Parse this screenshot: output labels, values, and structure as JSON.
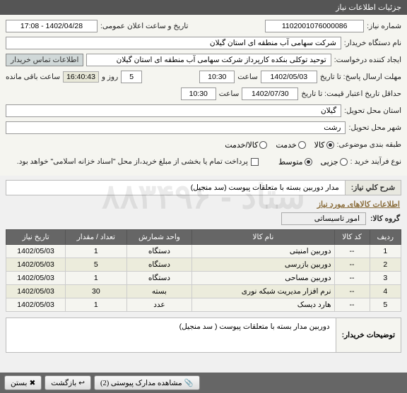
{
  "panel_title": "جزئیات اطلاعات نیاز",
  "watermark": "ستاد - ۸۸۳۴۹۶",
  "form": {
    "need_no_label": "شماره نیاز:",
    "need_no": "1102001076000086",
    "public_announce_label": "تاریخ و ساعت اعلان عمومی:",
    "public_announce": "1402/04/28 - 17:08",
    "buyer_org_label": "نام دستگاه خریدار:",
    "buyer_org": "شرکت سهامی آب منطقه ای استان گیلان",
    "requester_label": "ایجاد کننده درخواست:",
    "requester": "توحید توکلی بنکده کارپرداز شرکت سهامی آب منطقه ای استان گیلان",
    "contact_label": "اطلاعات تماس خریدار",
    "deadline_label": "مهلت ارسال پاسخ: تا تاریخ",
    "deadline_date": "1402/05/03",
    "time_label": "ساعت",
    "deadline_time": "10:30",
    "days": "5",
    "days_label": "روز و",
    "remaining_time": "16:40:43",
    "remaining_label": "ساعت باقی مانده",
    "credit_label": "حداقل تاریخ اعتبار قیمت: تا تاریخ",
    "credit_date": "1402/07/30",
    "credit_time": "10:30",
    "province_label": "استان محل تحویل:",
    "province": "گیلان",
    "city_label": "شهر محل تحویل:",
    "city": "رشت",
    "topic_class_label": "طبقه بندی موضوعی:",
    "topic_radios": {
      "goods": "کالا",
      "service": "خدمت",
      "both": "کالا/خدمت"
    },
    "buy_type_label": "نوع فرآیند خرید :",
    "buy_radios": {
      "small": "جزیی",
      "medium": "متوسط"
    },
    "payment_note": "پرداخت تمام یا بخشی از مبلغ خرید،از محل \"اسناد خزانه اسلامی\" خواهد بود."
  },
  "need_summary_label": "شرح کلي نياز:",
  "need_summary": "مدار دوربین بسته با متعلقات پیوست (سد منجیل)",
  "items_header": "اطلاعات کالاهای مورد نیاز",
  "group_label": "گروه کالا:",
  "group_value": "امور تاسیساتی",
  "columns": {
    "row": "ردیف",
    "code": "کد کالا",
    "name": "نام کالا",
    "unit": "واحد شمارش",
    "qty": "تعداد / مقدار",
    "date": "تاریخ نیاز"
  },
  "rows": [
    {
      "row": "1",
      "code": "--",
      "name": "دوربین امنیتی",
      "unit": "دستگاه",
      "qty": "1",
      "date": "1402/05/03"
    },
    {
      "row": "2",
      "code": "--",
      "name": "دوربین بازرسی",
      "unit": "دستگاه",
      "qty": "5",
      "date": "1402/05/03"
    },
    {
      "row": "3",
      "code": "--",
      "name": "دوربین مساحی",
      "unit": "دستگاه",
      "qty": "1",
      "date": "1402/05/03"
    },
    {
      "row": "4",
      "code": "--",
      "name": "نرم افزار مدیریت شبکه نوری",
      "unit": "بسته",
      "qty": "30",
      "date": "1402/05/03"
    },
    {
      "row": "5",
      "code": "--",
      "name": "هارد دیسک",
      "unit": "عدد",
      "qty": "1",
      "date": "1402/05/03"
    }
  ],
  "buyer_desc_label": "توضیحات خریدار:",
  "buyer_desc": "دوربین مدار بسته با متعلقات پیوست ( سد منجیل)",
  "footer": {
    "attachments": "مشاهده مدارک پیوستی (2)",
    "back": "بازگشت",
    "close": "بستن"
  }
}
